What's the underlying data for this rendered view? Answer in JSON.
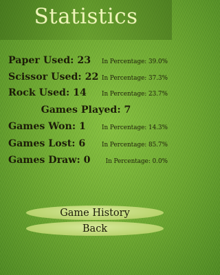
{
  "header": {
    "title": "Statistics"
  },
  "stats": {
    "paper": {
      "label": "Paper Used: 23",
      "percent": "In Percentage: 39.0%"
    },
    "scissor": {
      "label": "Scissor Used: 22",
      "percent": "In Percentage: 37.3%"
    },
    "rock": {
      "label": "Rock Used: 14",
      "percent": "In Percentage: 23.7%"
    },
    "played": {
      "label": "Games Played: 7"
    },
    "won": {
      "label": "Games Won: 1",
      "percent": "In Percentage: 14.3%"
    },
    "lost": {
      "label": "Games Lost: 6",
      "percent": "In Percentage: 85.7%"
    },
    "draw": {
      "label": "Games Draw: 0",
      "percent": "In Percentage: 0.0%"
    }
  },
  "buttons": {
    "history": "Game History",
    "back": "Back"
  },
  "colors": {
    "grass": "#6aa52e",
    "title_text": "#edf4b8",
    "button_fill": "#c4dc80",
    "text": "#1c1c08"
  }
}
